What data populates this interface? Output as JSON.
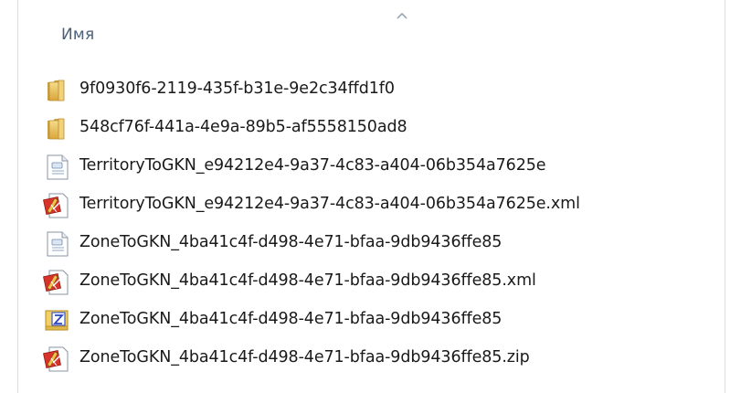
{
  "header": {
    "name_column": "Имя",
    "sort_indicator": "sort-ascending-icon"
  },
  "files": [
    {
      "name": "9f0930f6-2119-435f-b31e-9e2c34ffd1f0",
      "icon": "folder-icon"
    },
    {
      "name": "548cf76f-441a-4e9a-89b5-af5558150ad8",
      "icon": "folder-icon"
    },
    {
      "name": "TerritoryToGKN_e94212e4-9a37-4c83-a404-06b354a7625e",
      "icon": "generic-file-icon"
    },
    {
      "name": "TerritoryToGKN_e94212e4-9a37-4c83-a404-06b354a7625e.xml",
      "icon": "xml-file-icon"
    },
    {
      "name": "ZoneToGKN_4ba41c4f-d498-4e71-bfaa-9db9436ffe85",
      "icon": "generic-file-icon"
    },
    {
      "name": "ZoneToGKN_4ba41c4f-d498-4e71-bfaa-9db9436ffe85.xml",
      "icon": "xml-file-icon"
    },
    {
      "name": "ZoneToGKN_4ba41c4f-d498-4e71-bfaa-9db9436ffe85",
      "icon": "zip-folder-icon"
    },
    {
      "name": "ZoneToGKN_4ba41c4f-d498-4e71-bfaa-9db9436ffe85.zip",
      "icon": "xml-file-icon"
    }
  ]
}
